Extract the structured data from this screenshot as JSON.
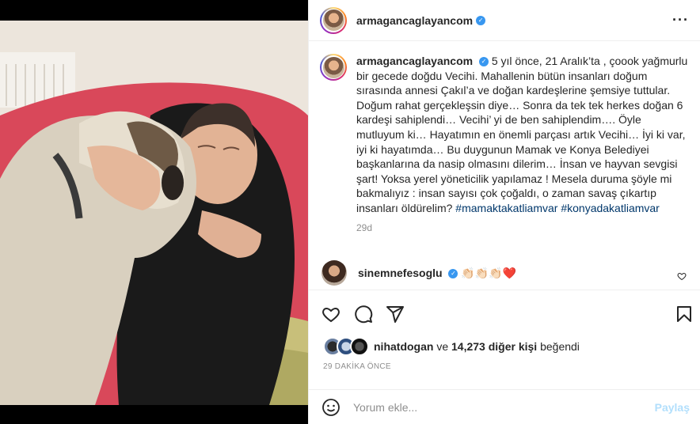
{
  "post": {
    "username": "armagancaglayancom",
    "caption": "5 yıl önce, 21 Aralık’ta , çoook yağmurlu bir gecede doğdu Vecihi. Mahallenin bütün insanları doğum sırasında annesi Çakıl’a ve doğan kardeşlerine şemsiye tuttular. Doğum rahat gerçekleşsin diye… Sonra da tek tek herkes doğan 6 kardeşi sahiplendi… Vecihi’ yi de ben sahiplendim…. Öyle mutluyum ki… Hayatımın en önemli parçası artık Vecihi… İyi ki var, iyi ki hayatımda… Bu duygunun Mamak ve Konya Belediyei başkanlarına da nasip olmasını dilerim… İnsan ve hayvan sevgisi şart! Yoksa yerel yöneticilik yapılamaz ! Mesela duruma şöyle mi bakmalıyız : insan sayısı çok çoğaldı, o zaman savaş çıkartıp insanları öldürelim?",
    "hashtags": "#mamaktakatliamvar #konyadakatliamvar",
    "caption_age": "29d"
  },
  "comment": {
    "username": "sinemnefesoglu",
    "text": "👏🏻👏🏻👏🏻❤️"
  },
  "likes": {
    "user": "nihatdogan",
    "connector": " ve ",
    "count": "14,273 diğer kişi",
    "suffix": " beğendi"
  },
  "posted_time": "29 DAKİKA ÖNCE",
  "comment_box": {
    "placeholder": "Yorum ekle...",
    "post_label": "Paylaş"
  },
  "icons": {
    "more": "more-options-icon",
    "like": "heart-icon",
    "comment": "comment-icon",
    "share": "share-icon",
    "save": "bookmark-icon",
    "emoji": "emoji-icon",
    "verified": "verified-badge-icon"
  },
  "colors": {
    "verified": "#3897f0",
    "hashtag": "#00376b",
    "post_button_disabled": "#b2dffc",
    "secondary_text": "#8e8e8e"
  }
}
